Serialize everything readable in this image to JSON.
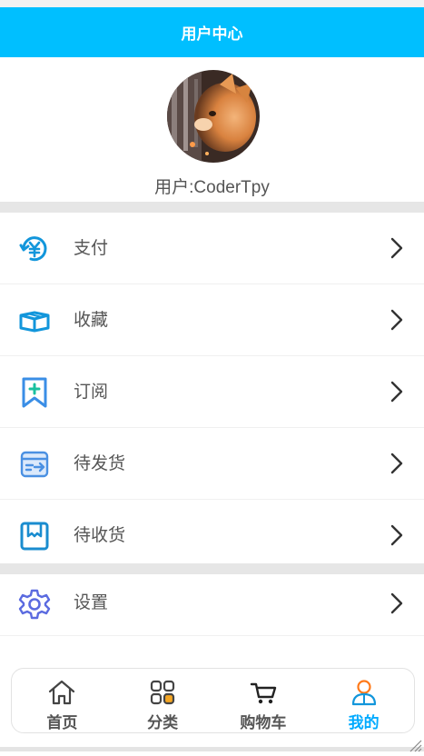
{
  "header": {
    "title": "用户中心"
  },
  "profile": {
    "avatar": "cat-photo",
    "username": "用户:CoderTpy"
  },
  "menu": [
    {
      "label": "支付",
      "icon": "yen-refresh-icon",
      "color": "#1296db"
    },
    {
      "label": "收藏",
      "icon": "box-icon",
      "color": "#1296db"
    },
    {
      "label": "订阅",
      "icon": "bookmark-plus-icon",
      "color": "#3a8ee6"
    },
    {
      "label": "待发货",
      "icon": "shipping-card-icon",
      "color": "#4a90e2"
    },
    {
      "label": "待收货",
      "icon": "receive-box-icon",
      "color": "#1a8ccf"
    },
    {
      "label": "设置",
      "icon": "gear-icon",
      "color": "#5b6be0"
    }
  ],
  "tabbar": {
    "tabs": [
      {
        "label": "首页",
        "icon": "home-icon",
        "active": false
      },
      {
        "label": "分类",
        "icon": "category-icon",
        "active": false
      },
      {
        "label": "购物车",
        "icon": "cart-icon",
        "active": false
      },
      {
        "label": "我的",
        "icon": "user-icon",
        "active": true
      }
    ]
  },
  "colors": {
    "accent": "#00bfff",
    "active_tab": "#00aaff"
  }
}
